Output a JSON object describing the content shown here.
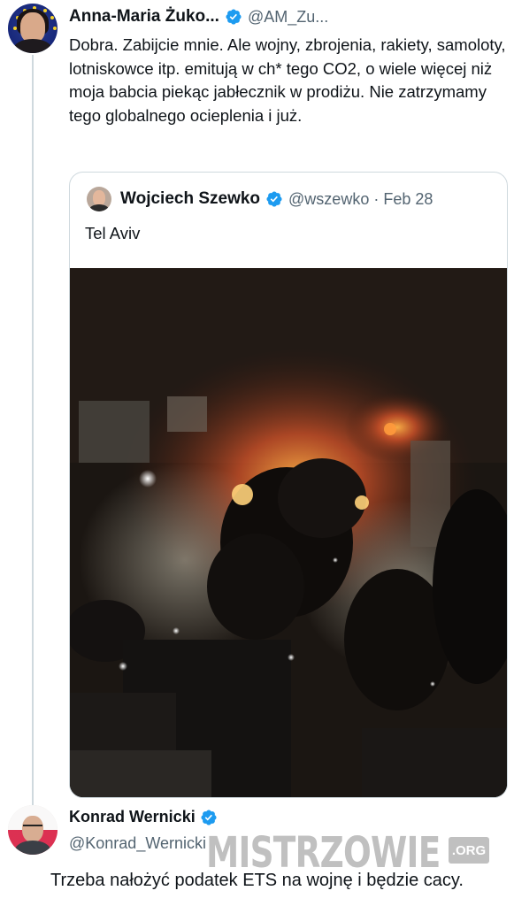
{
  "tweet": {
    "author_name": "Anna-Maria Żuko...",
    "author_handle": "@AM_Zu...",
    "text": "Dobra. Zabijcie mnie. Ale wojny, zbrojenia, rakiety, samoloty, lotniskowce itp. emitują w ch* tego CO2, o wiele więcej niż moja babcia piekąc jabłecznik w prodiżu. Nie zatrzymamy tego globalnego ocieplenia i już."
  },
  "quoted_tweet": {
    "author_name": "Wojciech Szewko",
    "author_handle": "@wszewko",
    "separator": "·",
    "date": "Feb 28",
    "text": "Tel Aviv"
  },
  "comment": {
    "author_name": "Konrad Wernicki",
    "author_handle": "@Konrad_Wernicki"
  },
  "watermark": {
    "text": "MISTRZOWIE",
    "badge": ".ORG"
  },
  "caption": "Trzeba nałożyć podatek ETS na wojnę i będzie cacy.",
  "icons": {
    "verified": "verified-badge-icon"
  },
  "colors": {
    "verified_blue": "#1d9bf0",
    "handle_gray": "#536471",
    "border": "#cfd9de"
  }
}
